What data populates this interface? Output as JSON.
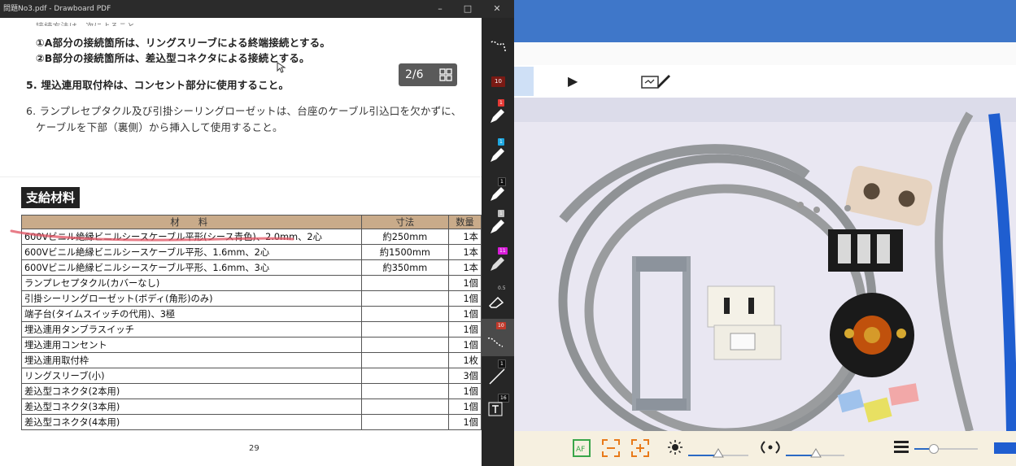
{
  "pdf_window": {
    "title": "問題No3.pdf - Drawboard PDF",
    "minimize": "–",
    "maximize": "□",
    "close": "✕",
    "lines": {
      "top_partial": "接続方法は、次によること。",
      "a_item": "①A部分の接続箇所は、リングスリーブによる終端接続とする。",
      "b_item": "②B部分の接続箇所は、差込型コネクタによる接続とする。",
      "item5": "5. 埋込連用取付枠は、コンセント部分に使用すること。",
      "item6_line1": "6. ランプレセプタクル及び引掛シーリングローゼットは、台座のケーブル引込口を欠かずに、",
      "item6_line2": "ケーブルを下部（裏側）から挿入して使用すること。"
    },
    "page_indicator": "2/6",
    "supply_heading": "支給材料",
    "table": {
      "headers": [
        "材　料",
        "寸法",
        "数量"
      ],
      "rows": [
        [
          "600Vビニル絶縁ビニルシースケーブル平形(シース青色)、2.0mm、2心",
          "約250mm",
          "1本"
        ],
        [
          "600Vビニル絶縁ビニルシースケーブル平形、1.6mm、2心",
          "約1500mm",
          "1本"
        ],
        [
          "600Vビニル絶縁ビニルシースケーブル平形、1.6mm、3心",
          "約350mm",
          "1本"
        ],
        [
          "ランプレセプタクル(カバーなし)",
          "",
          "1個"
        ],
        [
          "引掛シーリングローゼット(ボディ(角形)のみ)",
          "",
          "1個"
        ],
        [
          "端子台(タイムスイッチの代用)、3極",
          "",
          "1個"
        ],
        [
          "埋込連用タンブラスイッチ",
          "",
          "1個"
        ],
        [
          "埋込連用コンセント",
          "",
          "1個"
        ],
        [
          "埋込連用取付枠",
          "",
          "1枚"
        ],
        [
          "リングスリーブ(小)",
          "",
          "3個"
        ],
        [
          "差込型コネクタ(2本用)",
          "",
          "1個"
        ],
        [
          "差込型コネクタ(3本用)",
          "",
          "1個"
        ],
        [
          "差込型コネクタ(4本用)",
          "",
          "1個"
        ]
      ]
    },
    "page_number": "29",
    "tools": [
      {
        "name": "lasso-tool",
        "tag": "",
        "color": "#ffffff"
      },
      {
        "name": "number-tool",
        "tag": "10",
        "color": "#c0392b"
      },
      {
        "name": "pen-red",
        "tag": "1",
        "color": "#e53935"
      },
      {
        "name": "pen-cyan",
        "tag": "1",
        "color": "#1ea7e0"
      },
      {
        "name": "pen-black",
        "tag": "1",
        "color": "#111111"
      },
      {
        "name": "pen-white",
        "tag": "1",
        "color": "#bdbdbd"
      },
      {
        "name": "highlighter-magenta",
        "tag": "11",
        "color": "#d81bd8"
      },
      {
        "name": "eraser",
        "tag": "0.5",
        "color": "#444444"
      },
      {
        "name": "laser-dots",
        "tag": "10",
        "color": "#c0392b"
      },
      {
        "name": "line-tool",
        "tag": "1",
        "color": "#111111"
      },
      {
        "name": "text-tool",
        "tag": "16",
        "color": "#111111"
      }
    ]
  },
  "camera_app": {
    "accent": "#3f77c9",
    "play_label": "▶"
  }
}
